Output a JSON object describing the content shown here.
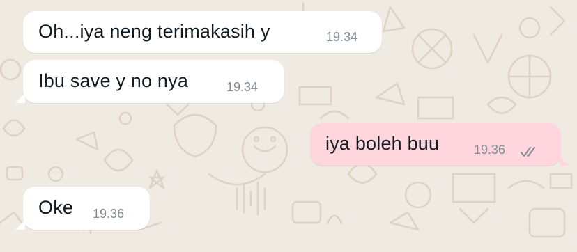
{
  "chat": {
    "messages": [
      {
        "direction": "incoming",
        "text": "Oh...iya neng terimakasih y",
        "time": "19.34"
      },
      {
        "direction": "incoming",
        "text": "Ibu save y no nya",
        "time": "19.34"
      },
      {
        "direction": "outgoing",
        "text": "iya boleh buu",
        "time": "19.36",
        "status": "read-ticks-icon"
      },
      {
        "direction": "incoming",
        "text": "Oke",
        "time": "19.36"
      }
    ]
  },
  "colors": {
    "background": "#efeae2",
    "incoming_bubble": "#ffffff",
    "outgoing_bubble": "#ffd6de",
    "text": "#111b21",
    "time": "#7f8a91",
    "doodle": "#ddd3c4"
  }
}
